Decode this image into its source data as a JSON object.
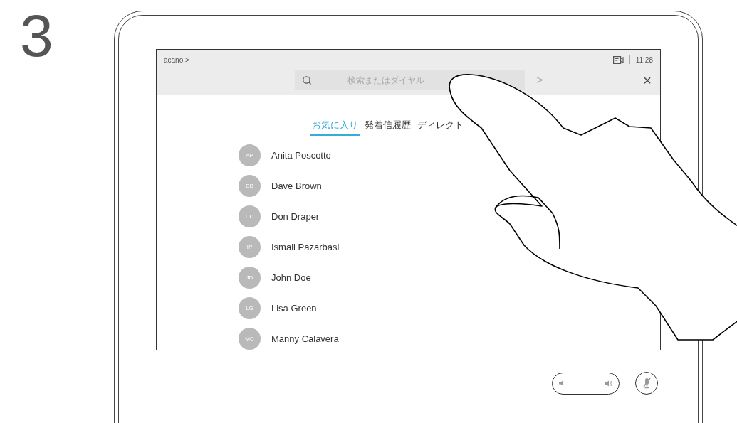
{
  "step": "3",
  "status_bar": {
    "breadcrumb": "acano >",
    "time": "11:28"
  },
  "search": {
    "placeholder": "検索またはダイヤル",
    "next": ">",
    "close": "×"
  },
  "tabs": [
    {
      "label": "お気に入り",
      "selected": true
    },
    {
      "label": "発着信履歴",
      "selected": false
    },
    {
      "label": "ディレクト",
      "selected": false
    }
  ],
  "contacts": [
    {
      "initials": "AP",
      "name": "Anita Poscotto"
    },
    {
      "initials": "DB",
      "name": "Dave Brown"
    },
    {
      "initials": "DD",
      "name": "Don Draper"
    },
    {
      "initials": "IP",
      "name": "Ismail Pazarbasi"
    },
    {
      "initials": "JD",
      "name": "John Doe"
    },
    {
      "initials": "LG",
      "name": "Lisa Green"
    },
    {
      "initials": "MC",
      "name": "Manny Calavera"
    }
  ]
}
